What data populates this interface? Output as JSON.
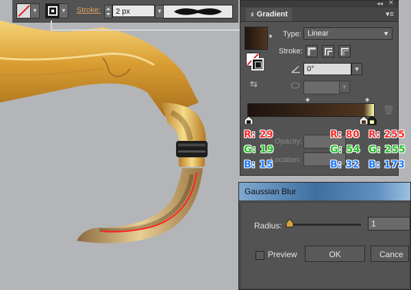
{
  "control_bar": {
    "stroke_label": "Stroke:",
    "stroke_weight": "2 px"
  },
  "gradient_panel": {
    "title": "Gradient",
    "type_label": "Type:",
    "type_value": "Linear",
    "stroke_label": "Stroke:",
    "angle_value": "0°",
    "opacity_label": "Opacity:",
    "location_label": "Location:",
    "stop_colors": [
      "#1d130f",
      "#503620",
      "#ffffad"
    ]
  },
  "annotations": [
    {
      "r": "R: 29",
      "g": "G: 19",
      "b": "B: 15"
    },
    {
      "r": "R: 80",
      "g": "G: 54",
      "b": "B: 32"
    },
    {
      "r": "R: 255",
      "g": "G: 255",
      "b": "B: 173"
    }
  ],
  "gaussian_blur": {
    "title": "Gaussian Blur",
    "radius_label": "Radius:",
    "radius_value": "1",
    "preview_label": "Preview",
    "ok_label": "OK",
    "cancel_label": "Cance"
  }
}
